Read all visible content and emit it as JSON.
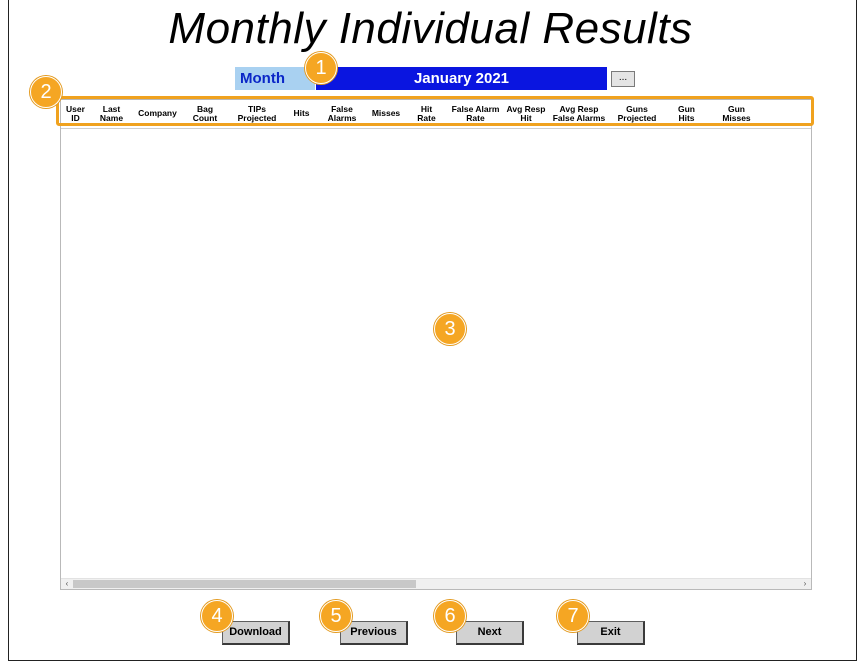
{
  "title": "Monthly Individual Results",
  "month": {
    "label": "Month",
    "value": "January 2021",
    "picker_label": "..."
  },
  "columns": [
    [
      "User",
      "ID"
    ],
    [
      "Last",
      "Name"
    ],
    [
      "Company"
    ],
    [
      "Bag",
      "Count"
    ],
    [
      "TIPs",
      "Projected"
    ],
    [
      "Hits"
    ],
    [
      "False",
      "Alarms"
    ],
    [
      "Misses"
    ],
    [
      "Hit",
      "Rate"
    ],
    [
      "False Alarm",
      "Rate"
    ],
    [
      "Avg Resp",
      "Hit"
    ],
    [
      "Avg Resp",
      "False Alarms"
    ],
    [
      "Guns",
      "Projected"
    ],
    [
      "Gun",
      "Hits"
    ],
    [
      "Gun",
      "Misses"
    ]
  ],
  "scroll": {
    "left_arrow": "‹",
    "right_arrow": "›"
  },
  "buttons": {
    "download": "Download",
    "previous": "Previous",
    "next": "Next",
    "exit": "Exit"
  },
  "callouts": [
    "1",
    "2",
    "3",
    "4",
    "5",
    "6",
    "7"
  ],
  "colors": {
    "accent": "#f5a623",
    "month_label_bg": "#a9d1f1",
    "month_value_bg": "#0a15e0"
  }
}
